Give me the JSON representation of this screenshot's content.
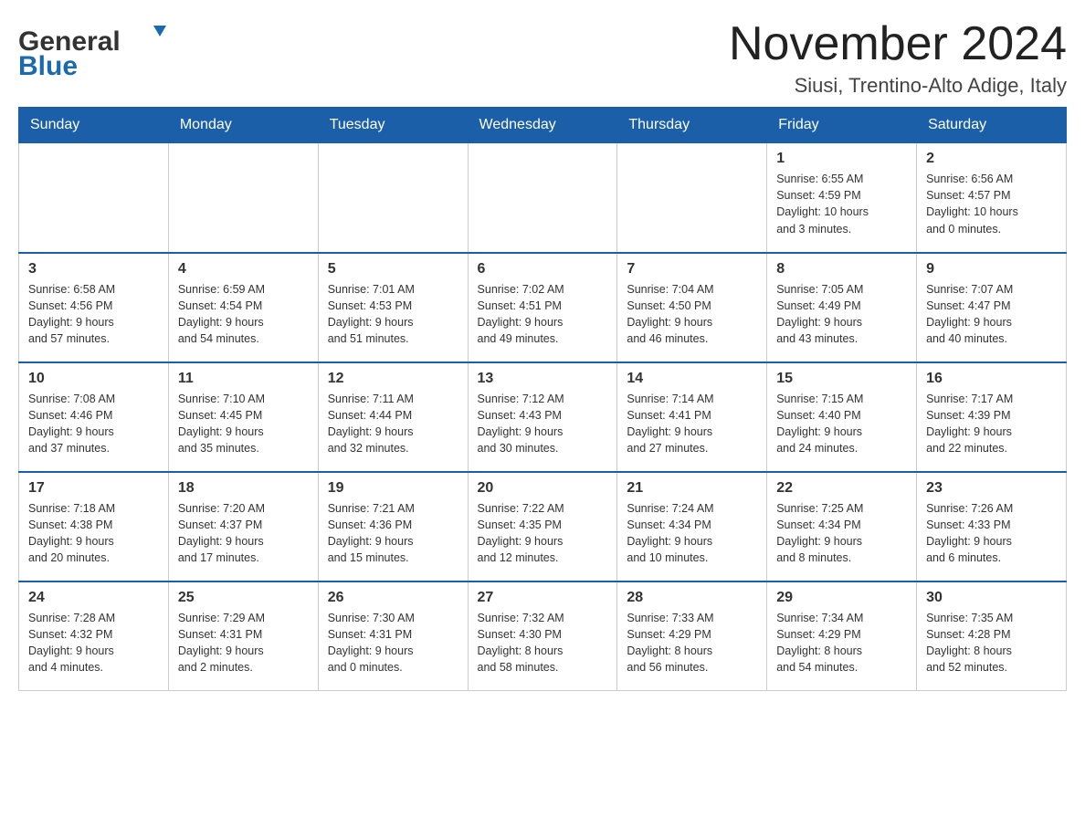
{
  "header": {
    "logo_text_general": "General",
    "logo_text_blue": "Blue",
    "title": "November 2024",
    "location": "Siusi, Trentino-Alto Adige, Italy"
  },
  "days_of_week": [
    "Sunday",
    "Monday",
    "Tuesday",
    "Wednesday",
    "Thursday",
    "Friday",
    "Saturday"
  ],
  "weeks": [
    {
      "days": [
        {
          "number": "",
          "info": ""
        },
        {
          "number": "",
          "info": ""
        },
        {
          "number": "",
          "info": ""
        },
        {
          "number": "",
          "info": ""
        },
        {
          "number": "",
          "info": ""
        },
        {
          "number": "1",
          "info": "Sunrise: 6:55 AM\nSunset: 4:59 PM\nDaylight: 10 hours\nand 3 minutes."
        },
        {
          "number": "2",
          "info": "Sunrise: 6:56 AM\nSunset: 4:57 PM\nDaylight: 10 hours\nand 0 minutes."
        }
      ]
    },
    {
      "days": [
        {
          "number": "3",
          "info": "Sunrise: 6:58 AM\nSunset: 4:56 PM\nDaylight: 9 hours\nand 57 minutes."
        },
        {
          "number": "4",
          "info": "Sunrise: 6:59 AM\nSunset: 4:54 PM\nDaylight: 9 hours\nand 54 minutes."
        },
        {
          "number": "5",
          "info": "Sunrise: 7:01 AM\nSunset: 4:53 PM\nDaylight: 9 hours\nand 51 minutes."
        },
        {
          "number": "6",
          "info": "Sunrise: 7:02 AM\nSunset: 4:51 PM\nDaylight: 9 hours\nand 49 minutes."
        },
        {
          "number": "7",
          "info": "Sunrise: 7:04 AM\nSunset: 4:50 PM\nDaylight: 9 hours\nand 46 minutes."
        },
        {
          "number": "8",
          "info": "Sunrise: 7:05 AM\nSunset: 4:49 PM\nDaylight: 9 hours\nand 43 minutes."
        },
        {
          "number": "9",
          "info": "Sunrise: 7:07 AM\nSunset: 4:47 PM\nDaylight: 9 hours\nand 40 minutes."
        }
      ]
    },
    {
      "days": [
        {
          "number": "10",
          "info": "Sunrise: 7:08 AM\nSunset: 4:46 PM\nDaylight: 9 hours\nand 37 minutes."
        },
        {
          "number": "11",
          "info": "Sunrise: 7:10 AM\nSunset: 4:45 PM\nDaylight: 9 hours\nand 35 minutes."
        },
        {
          "number": "12",
          "info": "Sunrise: 7:11 AM\nSunset: 4:44 PM\nDaylight: 9 hours\nand 32 minutes."
        },
        {
          "number": "13",
          "info": "Sunrise: 7:12 AM\nSunset: 4:43 PM\nDaylight: 9 hours\nand 30 minutes."
        },
        {
          "number": "14",
          "info": "Sunrise: 7:14 AM\nSunset: 4:41 PM\nDaylight: 9 hours\nand 27 minutes."
        },
        {
          "number": "15",
          "info": "Sunrise: 7:15 AM\nSunset: 4:40 PM\nDaylight: 9 hours\nand 24 minutes."
        },
        {
          "number": "16",
          "info": "Sunrise: 7:17 AM\nSunset: 4:39 PM\nDaylight: 9 hours\nand 22 minutes."
        }
      ]
    },
    {
      "days": [
        {
          "number": "17",
          "info": "Sunrise: 7:18 AM\nSunset: 4:38 PM\nDaylight: 9 hours\nand 20 minutes."
        },
        {
          "number": "18",
          "info": "Sunrise: 7:20 AM\nSunset: 4:37 PM\nDaylight: 9 hours\nand 17 minutes."
        },
        {
          "number": "19",
          "info": "Sunrise: 7:21 AM\nSunset: 4:36 PM\nDaylight: 9 hours\nand 15 minutes."
        },
        {
          "number": "20",
          "info": "Sunrise: 7:22 AM\nSunset: 4:35 PM\nDaylight: 9 hours\nand 12 minutes."
        },
        {
          "number": "21",
          "info": "Sunrise: 7:24 AM\nSunset: 4:34 PM\nDaylight: 9 hours\nand 10 minutes."
        },
        {
          "number": "22",
          "info": "Sunrise: 7:25 AM\nSunset: 4:34 PM\nDaylight: 9 hours\nand 8 minutes."
        },
        {
          "number": "23",
          "info": "Sunrise: 7:26 AM\nSunset: 4:33 PM\nDaylight: 9 hours\nand 6 minutes."
        }
      ]
    },
    {
      "days": [
        {
          "number": "24",
          "info": "Sunrise: 7:28 AM\nSunset: 4:32 PM\nDaylight: 9 hours\nand 4 minutes."
        },
        {
          "number": "25",
          "info": "Sunrise: 7:29 AM\nSunset: 4:31 PM\nDaylight: 9 hours\nand 2 minutes."
        },
        {
          "number": "26",
          "info": "Sunrise: 7:30 AM\nSunset: 4:31 PM\nDaylight: 9 hours\nand 0 minutes."
        },
        {
          "number": "27",
          "info": "Sunrise: 7:32 AM\nSunset: 4:30 PM\nDaylight: 8 hours\nand 58 minutes."
        },
        {
          "number": "28",
          "info": "Sunrise: 7:33 AM\nSunset: 4:29 PM\nDaylight: 8 hours\nand 56 minutes."
        },
        {
          "number": "29",
          "info": "Sunrise: 7:34 AM\nSunset: 4:29 PM\nDaylight: 8 hours\nand 54 minutes."
        },
        {
          "number": "30",
          "info": "Sunrise: 7:35 AM\nSunset: 4:28 PM\nDaylight: 8 hours\nand 52 minutes."
        }
      ]
    }
  ]
}
